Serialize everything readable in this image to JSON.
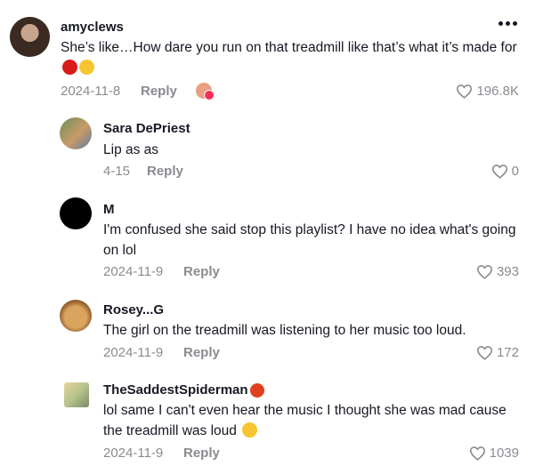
{
  "comments": [
    {
      "username": "amyclews",
      "text": "She’s like…How dare you run on that treadmill like that’s what it’s made for",
      "date": "2024-11-8",
      "reply_label": "Reply",
      "likes": "196.8K",
      "emojis": [
        "angry-face-emoji",
        "grinning-sweat-emoji"
      ]
    },
    {
      "username": "Sara DePriest",
      "text": "Lip as as",
      "date": "4-15",
      "reply_label": "Reply",
      "likes": "0"
    },
    {
      "username": "M",
      "text": "I'm confused she said stop this playlist? I have no idea what's going on lol",
      "date": "2024-11-9",
      "reply_label": "Reply",
      "likes": "393"
    },
    {
      "username": "Rosey...G",
      "text": "The girl on the treadmill was listening to her music too loud.",
      "date": "2024-11-9",
      "reply_label": "Reply",
      "likes": "172"
    },
    {
      "username": "TheSaddestSpiderman",
      "text": "lol same I can't even hear the music I thought she was mad cause the treadmill was loud",
      "date": "2024-11-9",
      "reply_label": "Reply",
      "likes": "1039",
      "emojis": [
        "grinning-sweat-emoji"
      ]
    }
  ],
  "colors": {
    "text": "#161823",
    "muted": "#8a8b91",
    "angry_emoji": "#d91a1a",
    "emoji_yellow": "#f7c531",
    "creator_badge": "#fe2c55"
  }
}
